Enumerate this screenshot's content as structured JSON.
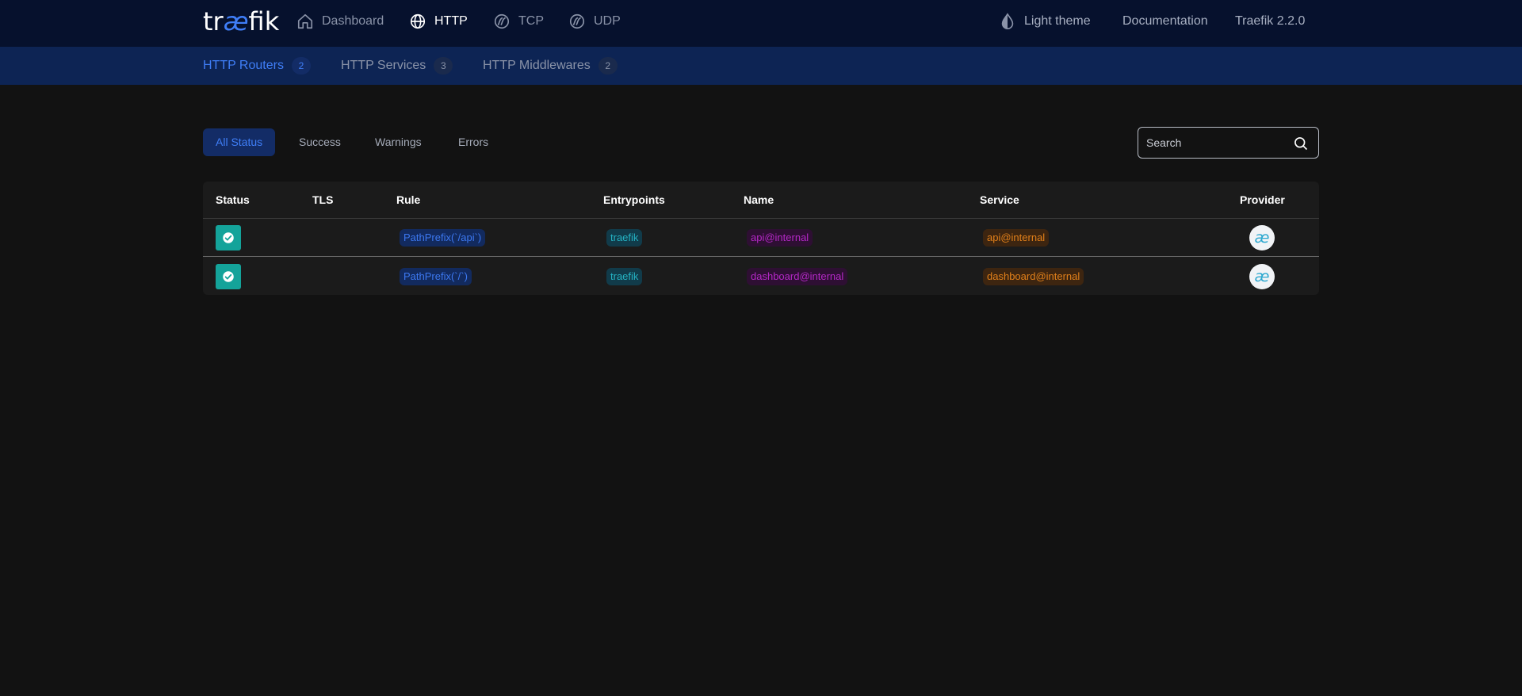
{
  "nav": {
    "logo_prefix": "tr",
    "logo_ae": "æ",
    "logo_suffix": "fik",
    "items": [
      {
        "label": "Dashboard",
        "icon": "home-icon"
      },
      {
        "label": "HTTP",
        "icon": "globe-icon",
        "active": true
      },
      {
        "label": "TCP",
        "icon": "tcp-icon"
      },
      {
        "label": "UDP",
        "icon": "udp-icon"
      }
    ],
    "theme_label": "Light theme",
    "docs_label": "Documentation",
    "version_label": "Traefik 2.2.0"
  },
  "subnav": {
    "tabs": [
      {
        "label": "HTTP Routers",
        "count": "2",
        "active": true
      },
      {
        "label": "HTTP Services",
        "count": "3"
      },
      {
        "label": "HTTP Middlewares",
        "count": "2"
      }
    ]
  },
  "filters": [
    "All Status",
    "Success",
    "Warnings",
    "Errors"
  ],
  "search": {
    "placeholder": "Search"
  },
  "table": {
    "headers": [
      "Status",
      "TLS",
      "Rule",
      "Entrypoints",
      "Name",
      "Service",
      "Provider"
    ],
    "rows": [
      {
        "status": "success",
        "tls": "",
        "rule": "PathPrefix(`/api`)",
        "entrypoints": "traefik",
        "name": "api@internal",
        "service": "api@internal",
        "provider": "internal"
      },
      {
        "status": "success",
        "tls": "",
        "rule": "PathPrefix(`/`)",
        "entrypoints": "traefik",
        "name": "dashboard@internal",
        "service": "dashboard@internal",
        "provider": "internal"
      }
    ]
  },
  "colors": {
    "accent": "#3f7ef7",
    "success": "#14a39a",
    "topnav_bg": "#06112d",
    "subnav_bg": "#0d2454"
  }
}
